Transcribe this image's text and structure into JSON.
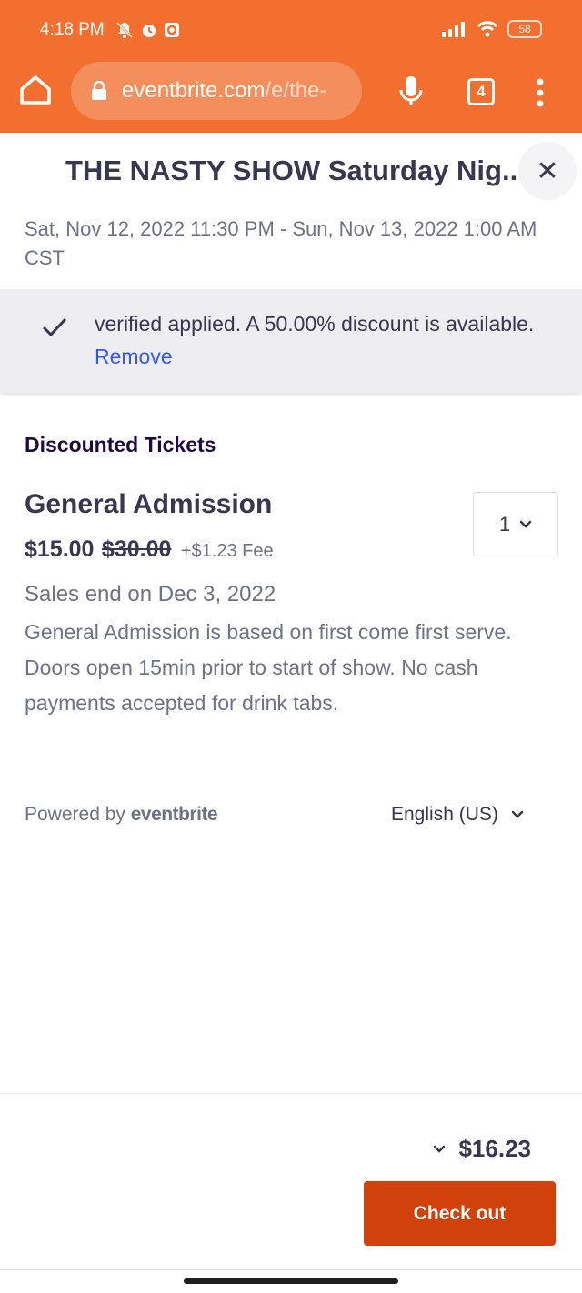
{
  "status_bar": {
    "time": "4:18 PM",
    "battery": "58"
  },
  "browser": {
    "url_host": "eventbrite.com",
    "url_path": "/e/the-",
    "tab_count": "4",
    "chrome_color": "#f26f30"
  },
  "event": {
    "title": "THE NASTY SHOW Saturday Nig...",
    "date": "Sat, Nov 12, 2022 11:30 PM - Sun, Nov 13, 2022 1:00 AM CST",
    "close_label": "✕"
  },
  "discount_banner": {
    "message": "verified applied. A 50.00% discount is available.",
    "remove_label": "Remove"
  },
  "tickets_section": {
    "heading": "Discounted Tickets",
    "ticket": {
      "name": "General Admission",
      "quantity": "1",
      "price": "$15.00",
      "original_price": "$30.00",
      "fee": "+$1.23 Fee",
      "sales_end": "Sales end on Dec 3, 2022",
      "description": "General Admission is based on first come first serve. Doors open 15min prior to start of show. No cash payments accepted for drink tabs."
    }
  },
  "footer": {
    "powered_by": "Powered by",
    "brand": "eventbrite",
    "language": "English (US)"
  },
  "checkout": {
    "total": "$16.23",
    "button_label": "Check out",
    "button_color": "#d1410c"
  }
}
